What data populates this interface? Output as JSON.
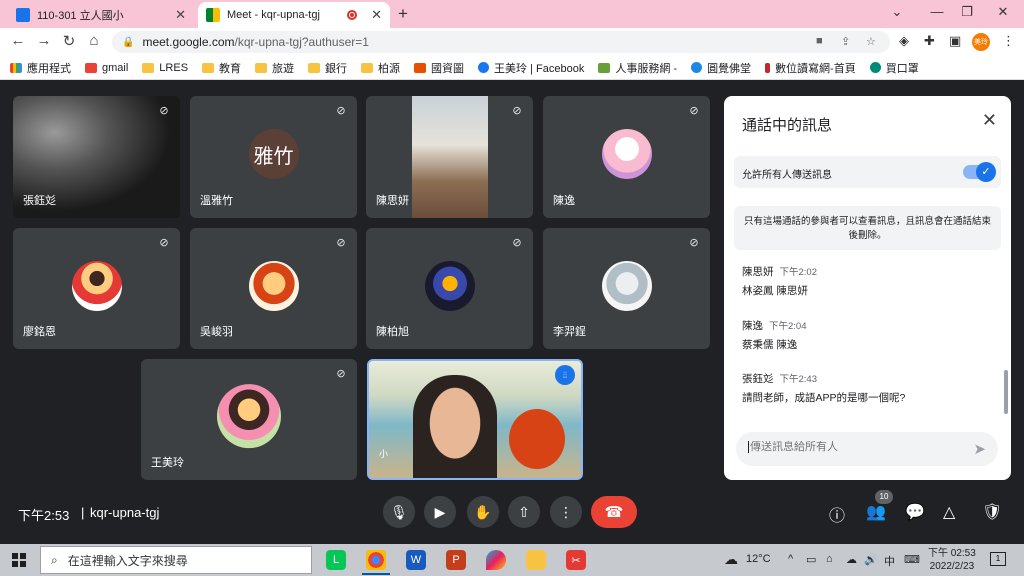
{
  "browser": {
    "tabs": [
      {
        "title": "110-301 立人國小",
        "active": false
      },
      {
        "title": "Meet - kqr-upna-tgj",
        "active": true
      }
    ],
    "url_host": "meet.google.com",
    "url_path": "/kqr-upna-tgj?authuser=1",
    "profile_label": "美玲",
    "bookmarks": [
      "應用程式",
      "gmail",
      "LRES",
      "教育",
      "旅遊",
      "銀行",
      "柏源",
      "國資圖",
      "王美玲 | Facebook",
      "人事服務網 -",
      "圓覺佛堂",
      "數位讀寫網-首頁",
      "買口罩"
    ]
  },
  "meet": {
    "participants": [
      {
        "name": "張鈺彣",
        "avatar": "video-blur"
      },
      {
        "name": "溫雅竹",
        "avatar": "雅竹"
      },
      {
        "name": "陳思妍",
        "avatar": "video"
      },
      {
        "name": "陳逸",
        "avatar": "anime-girl-icon"
      },
      {
        "name": "廖銘恩",
        "avatar": "luffy-icon"
      },
      {
        "name": "吳峻羽",
        "avatar": "child-photo"
      },
      {
        "name": "陳柏旭",
        "avatar": "robot-photo"
      },
      {
        "name": "李羿鋥",
        "avatar": "anime-mask-icon"
      },
      {
        "name": "王美玲",
        "avatar": "girl-photo"
      }
    ],
    "self_tile_caption": "小",
    "time": "下午2:53",
    "separator": "|",
    "meeting_code": "kqr-upna-tgj",
    "participant_count": "10"
  },
  "chat": {
    "title": "通話中的訊息",
    "allow_label": "允許所有人傳送訊息",
    "allow_enabled": true,
    "notice": "只有這場通話的參與者可以查看訊息，且訊息會在通話結束後刪除。",
    "messages": [
      {
        "sender": "陳思妍",
        "time": "下午2:02",
        "body": "林姿鳳  陳思妍"
      },
      {
        "sender": "陳逸",
        "time": "下午2:04",
        "body": "蔡秉儒  陳逸"
      },
      {
        "sender": "張鈺彣",
        "time": "下午2:43",
        "body": "請問老師，成語APP的是哪一個呢?"
      }
    ],
    "input_placeholder": "傳送訊息給所有人"
  },
  "taskbar": {
    "search_placeholder": "在這裡輸入文字來搜尋",
    "weather": "12°C",
    "ime": "中",
    "clock_time": "下午 02:53",
    "clock_date": "2022/2/23",
    "notifications": "1"
  },
  "colors": {
    "tabbar": "#f7c5d5",
    "meet_bg": "#202124",
    "tile_bg": "#3c4043",
    "accent": "#1a73e8",
    "hangup": "#ea4335",
    "active_speaker": "#8ab4f8"
  }
}
